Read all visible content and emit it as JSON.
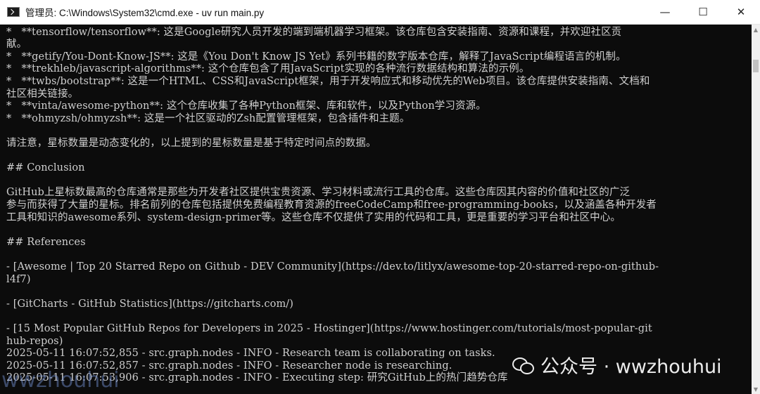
{
  "window": {
    "title": "管理员: C:\\Windows\\System32\\cmd.exe - uv  run main.py",
    "icon": "cmd-icon",
    "controls": {
      "minimize": "—",
      "maximize": "☐",
      "close": "✕"
    }
  },
  "console": {
    "lines": [
      "*   **tensorflow/tensorflow**: 这是Google研究人员开发的端到端机器学习框架。该仓库包含安装指南、资源和课程，并欢迎社区贡",
      "献。",
      "*   **getify/You-Dont-Know-JS**: 这是《You Don't Know JS Yet》系列书籍的数字版本仓库，解释了JavaScript编程语言的机制。",
      "*   **trekhleb/javascript-algorithms**: 这个仓库包含了用JavaScript实现的各种流行数据结构和算法的示例。",
      "*   **twbs/bootstrap**: 这是一个HTML、CSS和JavaScript框架，用于开发响应式和移动优先的Web项目。该仓库提供安装指南、文档和",
      "社区相关链接。",
      "*   **vinta/awesome-python**: 这个仓库收集了各种Python框架、库和软件，以及Python学习资源。",
      "*   **ohmyzsh/ohmyzsh**: 这是一个社区驱动的Zsh配置管理框架，包含插件和主题。",
      "",
      "请注意，星标数量是动态变化的，以上提到的星标数量是基于特定时间点的数据。",
      "",
      "## Conclusion",
      "",
      "GitHub上星标数最高的仓库通常是那些为开发者社区提供宝贵资源、学习材料或流行工具的仓库。这些仓库因其内容的价值和社区的广泛",
      "参与而获得了大量的星标。排名前列的仓库包括提供免费编程教育资源的freeCodeCamp和free-programming-books，以及涵盖各种开发者",
      "工具和知识的awesome系列、system-design-primer等。这些仓库不仅提供了实用的代码和工具，更是重要的学习平台和社区中心。",
      "",
      "## References",
      "",
      "- [Awesome | Top 20 Starred Repo on Github - DEV Community](https://dev.to/litlyx/awesome-top-20-starred-repo-on-github-",
      "l4f7)",
      "",
      "- [GitCharts - GitHub Statistics](https://gitcharts.com/)",
      "",
      "- [15 Most Popular GitHub Repos for Developers in 2025 - Hostinger](https://www.hostinger.com/tutorials/most-popular-git",
      "hub-repos)",
      "2025-05-11 16:07:52,855 - src.graph.nodes - INFO - Research team is collaborating on tasks.",
      "2025-05-11 16:07:52,857 - src.graph.nodes - INFO - Researcher node is researching.",
      "2025-05-11 16:07:53,906 - src.graph.nodes - INFO - Executing step: 研究GitHub上的热门趋势仓库"
    ]
  },
  "watermark": {
    "text": "公众号 · wwzhouhui",
    "left_text": "wwzhouhui"
  },
  "colors": {
    "console_bg": "#0c0c0c",
    "console_fg": "#cfcfcf",
    "titlebar_bg": "#ffffff"
  }
}
